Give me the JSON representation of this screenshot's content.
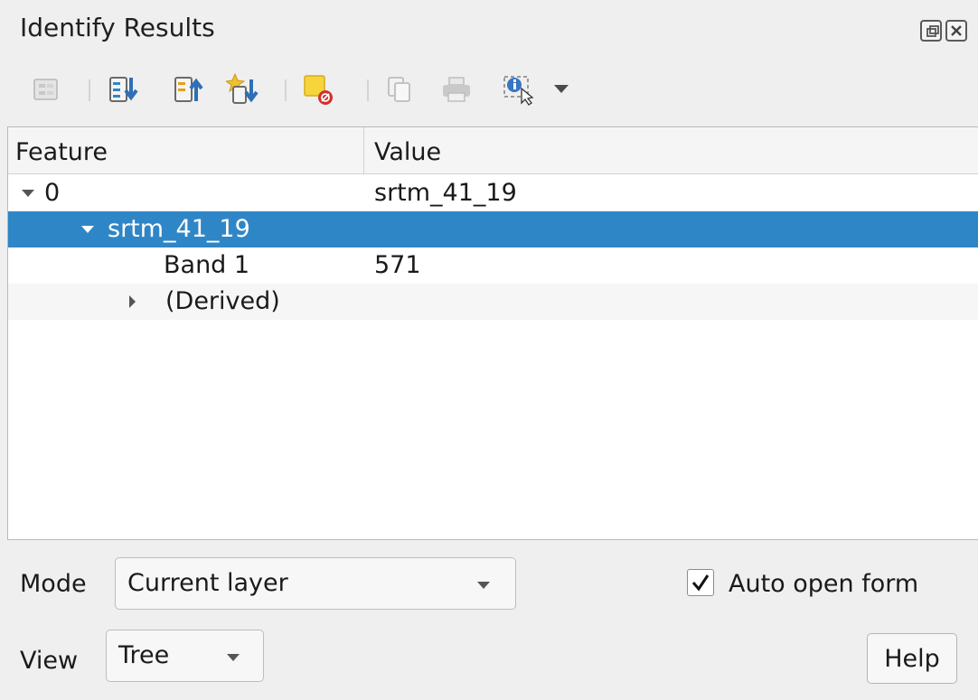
{
  "window": {
    "title": "Identify Results"
  },
  "toolbar": {
    "icons": [
      "expand-tree-icon",
      "expand-all-icon",
      "collapse-all-icon",
      "expand-new-results-icon",
      "clear-results-icon",
      "copy-feature-icon",
      "print-icon",
      "identify-select-mode-icon"
    ]
  },
  "tree": {
    "columns": [
      "Feature",
      "Value"
    ],
    "rows": [
      {
        "feature": "0",
        "value": "srtm_41_19",
        "expanded": true
      },
      {
        "feature": "srtm_41_19",
        "value": "",
        "expanded": true,
        "selected": true
      },
      {
        "feature": "Band 1",
        "value": "571"
      },
      {
        "feature": "(Derived)",
        "value": "",
        "expanded": false
      }
    ]
  },
  "controls": {
    "mode_label": "Mode",
    "mode_value": "Current layer",
    "auto_open_label": "Auto open form",
    "auto_open_checked": true,
    "view_label": "View",
    "view_value": "Tree",
    "help_label": "Help"
  },
  "colors": {
    "selection": "#2f86c6",
    "background": "#efefef"
  }
}
